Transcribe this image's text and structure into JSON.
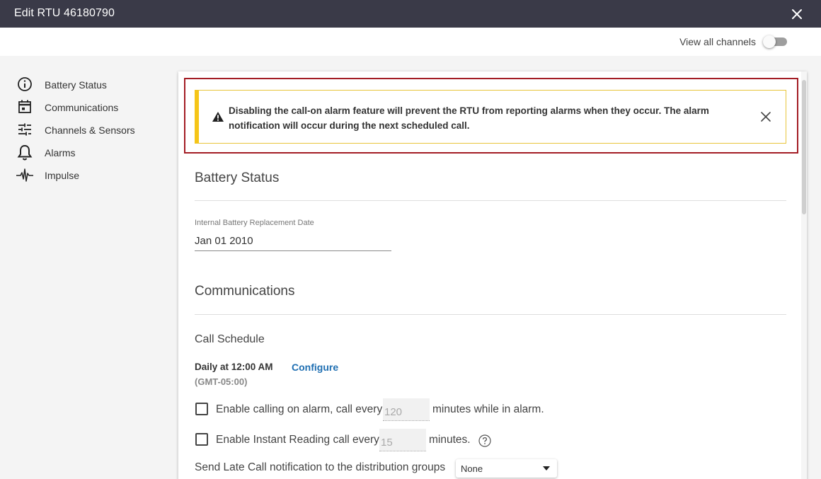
{
  "window": {
    "title": "Edit RTU 46180790"
  },
  "subbar": {
    "view_all_label": "View all channels",
    "view_all_enabled": false
  },
  "sidebar": {
    "items": [
      {
        "label": "Battery Status",
        "icon": "info-circle-icon"
      },
      {
        "label": "Communications",
        "icon": "calendar-icon"
      },
      {
        "label": "Channels & Sensors",
        "icon": "sliders-icon"
      },
      {
        "label": "Alarms",
        "icon": "bell-icon"
      },
      {
        "label": "Impulse",
        "icon": "pulse-icon"
      }
    ]
  },
  "alert": {
    "message": "Disabling the call-on alarm feature will prevent the RTU from reporting alarms when they occur. The alarm notification will occur during the next scheduled call.",
    "icon": "warning-icon",
    "accent": "#f5c518"
  },
  "battery": {
    "title": "Battery Status",
    "field_label": "Internal Battery Replacement Date",
    "field_value": "Jan 01 2010"
  },
  "communications": {
    "title": "Communications",
    "call_schedule_title": "Call Schedule",
    "schedule_text": "Daily at 12:00 AM",
    "timezone": "(GMT-05:00)",
    "configure_label": "Configure",
    "alarm_call": {
      "checked": false,
      "pre": "Enable calling on alarm, call every",
      "value": "120",
      "post": "minutes while in alarm."
    },
    "instant_call": {
      "checked": false,
      "pre": "Enable Instant Reading call every",
      "value": "15",
      "post": "minutes."
    },
    "late_call": {
      "label": "Send Late Call notification to the distribution groups",
      "selected": "None"
    }
  },
  "colors": {
    "titlebar": "#3a3a48",
    "link": "#1f6fb2",
    "highlight_border": "#a31d25"
  }
}
